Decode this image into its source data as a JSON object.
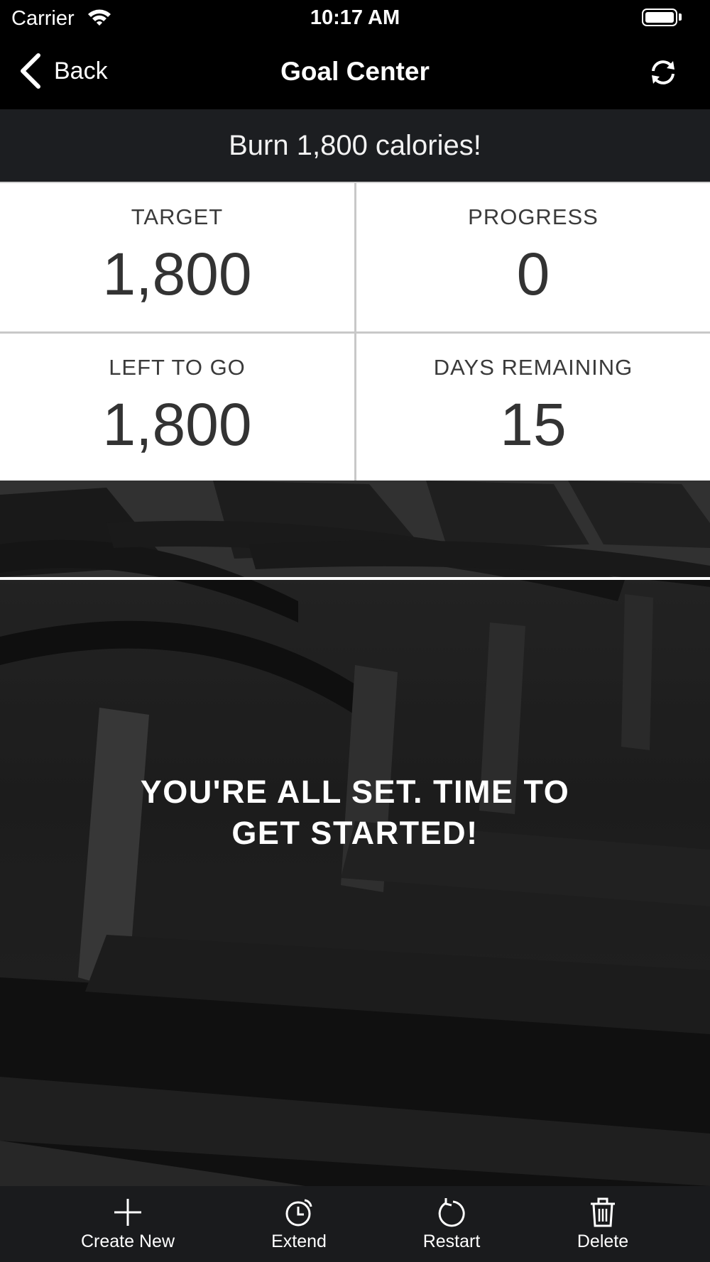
{
  "status_bar": {
    "carrier": "Carrier",
    "time": "10:17 AM"
  },
  "nav": {
    "back_label": "Back",
    "title": "Goal Center",
    "refresh_icon": "refresh-icon"
  },
  "goal": {
    "headline": "Burn 1,800 calories!"
  },
  "stats": {
    "target": {
      "label": "TARGET",
      "value": "1,800"
    },
    "progress": {
      "label": "PROGRESS",
      "value": "0"
    },
    "left": {
      "label": "LEFT TO GO",
      "value": "1,800"
    },
    "days": {
      "label": "DAYS REMAINING",
      "value": "15"
    }
  },
  "message": {
    "line1": "YOU'RE ALL SET. TIME TO",
    "line2": "GET STARTED!"
  },
  "tabs": [
    {
      "label": "Create New",
      "icon": "plus-icon"
    },
    {
      "label": "Extend",
      "icon": "timer-icon"
    },
    {
      "label": "Restart",
      "icon": "restart-icon"
    },
    {
      "label": "Delete",
      "icon": "trash-icon"
    }
  ]
}
